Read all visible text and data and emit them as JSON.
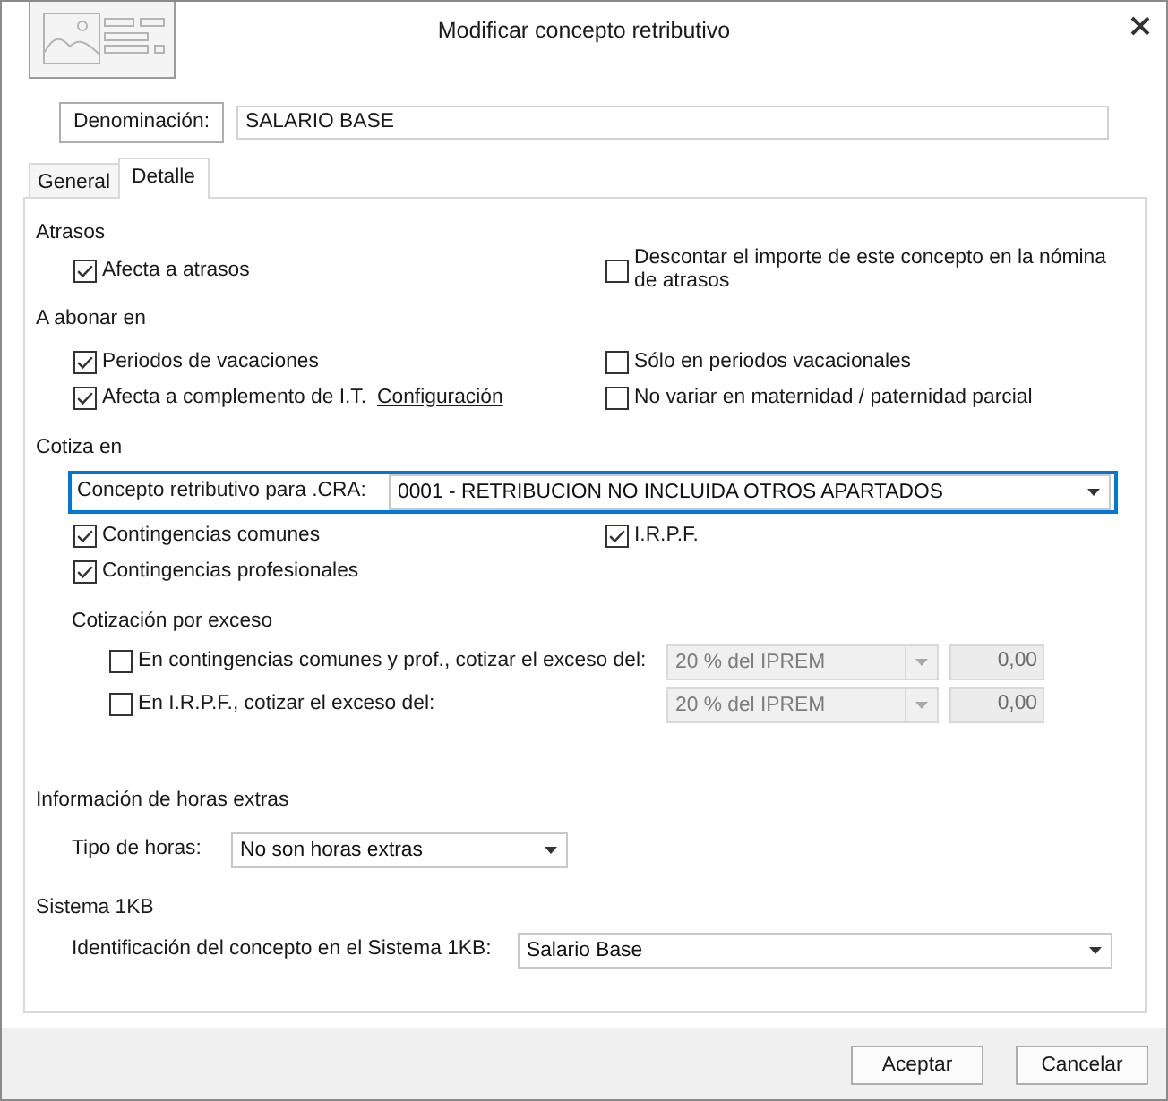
{
  "window": {
    "title": "Modificar concepto retributivo"
  },
  "denominacion": {
    "label": "Denominación:",
    "value": "SALARIO BASE"
  },
  "tabs": [
    {
      "label": "General",
      "selected": false
    },
    {
      "label": "Detalle",
      "selected": true
    }
  ],
  "atrasos": {
    "heading": "Atrasos",
    "options": [
      {
        "label": "Afecta a atrasos",
        "checked": true
      },
      {
        "label": "Descontar el importe de este concepto en la nómina de atrasos",
        "checked": false
      }
    ]
  },
  "abonar_en": {
    "heading": "A abonar en",
    "options": [
      {
        "label": "Periodos de vacaciones",
        "checked": true
      },
      {
        "label": "Sólo en periodos vacacionales",
        "checked": false
      },
      {
        "label": "Afecta a complemento de I.T.",
        "checked": true,
        "link": "Configuración"
      },
      {
        "label": "No variar en maternidad / paternidad parcial",
        "checked": false
      }
    ]
  },
  "cotiza_en": {
    "heading": "Cotiza en",
    "cra": {
      "label": "Concepto retributivo para .CRA:",
      "value": "0001 - RETRIBUCION NO INCLUIDA OTROS APARTADOS",
      "focused": true
    },
    "options": [
      {
        "label": "Contingencias comunes",
        "checked": true
      },
      {
        "label": "I.R.P.F.",
        "checked": true
      },
      {
        "label": "Contingencias profesionales",
        "checked": true
      }
    ],
    "exceso": {
      "heading": "Cotización por exceso",
      "rows": [
        {
          "label": "En contingencias comunes y prof., cotizar el exceso del:",
          "checked": false,
          "base": "20 % del IPREM",
          "amount": "0,00",
          "disabled": true
        },
        {
          "label": "En I.R.P.F., cotizar el exceso del:",
          "checked": false,
          "base": "20 % del IPREM",
          "amount": "0,00",
          "disabled": true
        }
      ]
    }
  },
  "horas_extras": {
    "heading": "Información de horas extras",
    "label": "Tipo de horas:",
    "value": "No son horas extras"
  },
  "sistema_1kb": {
    "heading": "Sistema 1KB",
    "label": "Identificación del concepto en el Sistema 1KB:",
    "value": "Salario Base"
  },
  "buttons": [
    "Aceptar",
    "Cancelar"
  ]
}
